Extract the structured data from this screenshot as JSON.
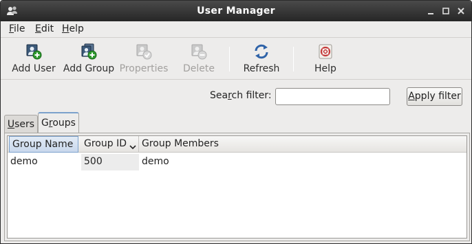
{
  "window": {
    "title": "User Manager"
  },
  "menubar": {
    "items": [
      {
        "mnemonic": "F",
        "rest": "ile"
      },
      {
        "mnemonic": "E",
        "rest": "dit"
      },
      {
        "mnemonic": "H",
        "rest": "elp"
      }
    ]
  },
  "toolbar": {
    "add_user": "Add User",
    "add_group": "Add Group",
    "properties": "Properties",
    "delete": "Delete",
    "refresh": "Refresh",
    "help": "Help"
  },
  "search": {
    "label_pre": "Sea",
    "label_mnemonic": "r",
    "label_post": "ch filter:",
    "value": "",
    "apply_mnemonic": "A",
    "apply_rest": "pply filter"
  },
  "tabs": {
    "users_mnemonic": "U",
    "users_rest": "sers",
    "groups_pre": "G",
    "groups_mnemonic": "r",
    "groups_post": "oups",
    "active": "Groups"
  },
  "table": {
    "columns": [
      "Group Name",
      "Group ID",
      "Group Members"
    ],
    "sort_column": "Group ID",
    "sort_direction": "descending",
    "rows": [
      {
        "name": "demo",
        "id": "500",
        "members": "demo"
      }
    ]
  },
  "colors": {
    "titlebar": "#333333",
    "accent": "#7ba1cc",
    "disabled_text": "#a2a09e"
  }
}
